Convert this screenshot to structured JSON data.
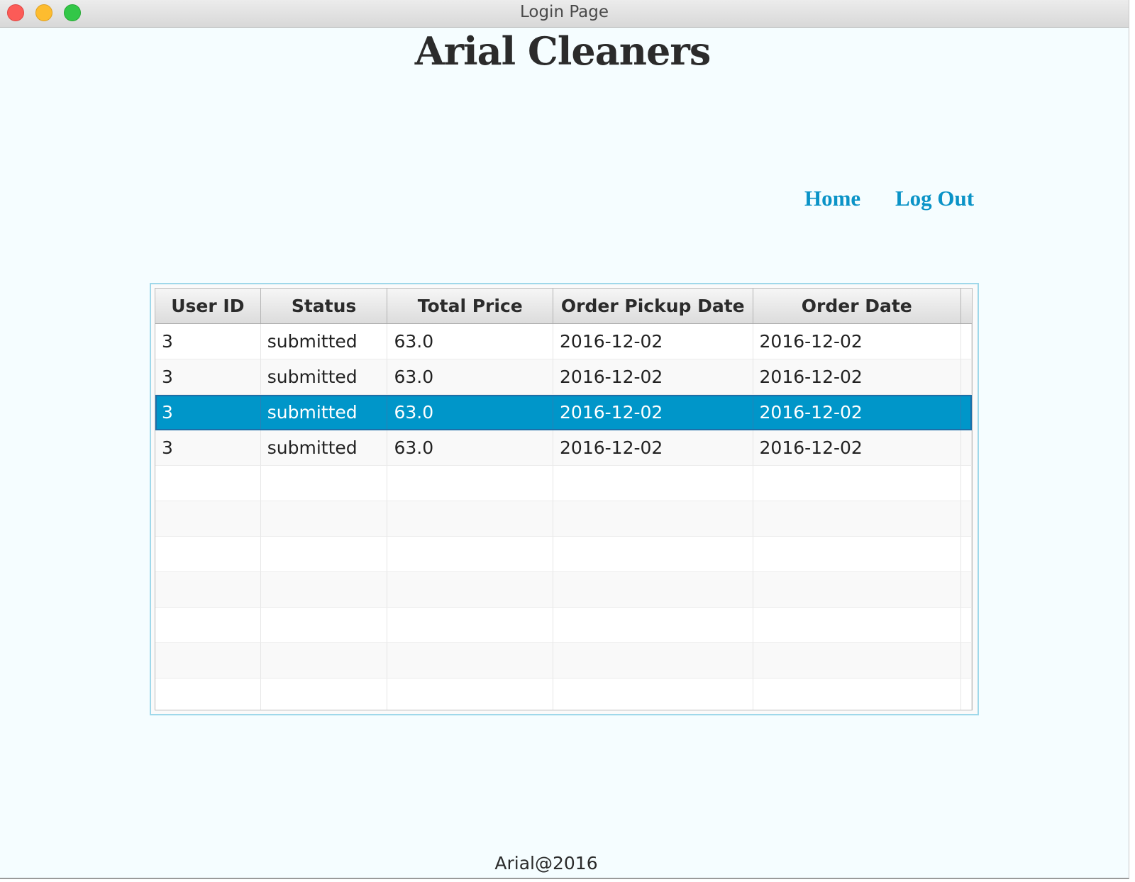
{
  "window": {
    "title": "Login Page"
  },
  "app": {
    "title": "Arial Cleaners"
  },
  "nav": {
    "home": "Home",
    "logout": "Log Out"
  },
  "table": {
    "headers": [
      "User ID",
      "Status",
      "Total Price",
      "Order Pickup Date",
      "Order Date"
    ],
    "rows": [
      [
        "3",
        "submitted",
        "63.0",
        "2016-12-02",
        "2016-12-02"
      ],
      [
        "3",
        "submitted",
        "63.0",
        "2016-12-02",
        "2016-12-02"
      ],
      [
        "3",
        "submitted",
        "63.0",
        "2016-12-02",
        "2016-12-02"
      ],
      [
        "3",
        "submitted",
        "63.0",
        "2016-12-02",
        "2016-12-02"
      ]
    ],
    "selected_row_index": 2
  },
  "footer": {
    "text": "Arial@2016"
  },
  "colors": {
    "link": "#0a93c7",
    "selection": "#0096c9",
    "background": "#f5fdff"
  }
}
